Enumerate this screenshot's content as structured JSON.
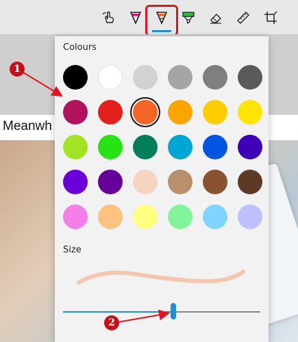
{
  "toolbar": {
    "tools": [
      {
        "icon": "touch-writing-icon"
      },
      {
        "icon": "ballpoint-pen-icon",
        "color": "#d6147a"
      },
      {
        "icon": "pencil-icon",
        "color": "#f26522"
      },
      {
        "icon": "highlighter-icon",
        "color": "#2dbe3b"
      },
      {
        "icon": "eraser-icon"
      },
      {
        "icon": "ruler-icon"
      },
      {
        "icon": "crop-icon"
      }
    ],
    "active_tool": "pencil-icon"
  },
  "page": {
    "text": "Meanwh"
  },
  "panel": {
    "colours_label": "Colours",
    "size_label": "Size",
    "swatches": [
      "#000000",
      "#ffffff",
      "#d2d2d2",
      "#a5a5a5",
      "#7f7f7f",
      "#5a5a5a",
      "#b0125b",
      "#e3201b",
      "#f26522",
      "#fba500",
      "#ffcc00",
      "#ffe600",
      "#a3e326",
      "#26e314",
      "#007f5a",
      "#00a6d2",
      "#0055e3",
      "#3d00b8",
      "#6b00d6",
      "#660099",
      "#f5d5c2",
      "#b8906b",
      "#8a5230",
      "#5c3a26",
      "#f57fe8",
      "#fdc27d",
      "#ffff80",
      "#80f59a",
      "#7fd5ff",
      "#bfbfff"
    ],
    "selected_index": 8,
    "size_value": 0.56
  },
  "annotations": {
    "badge_1": "1",
    "badge_2": "2"
  }
}
